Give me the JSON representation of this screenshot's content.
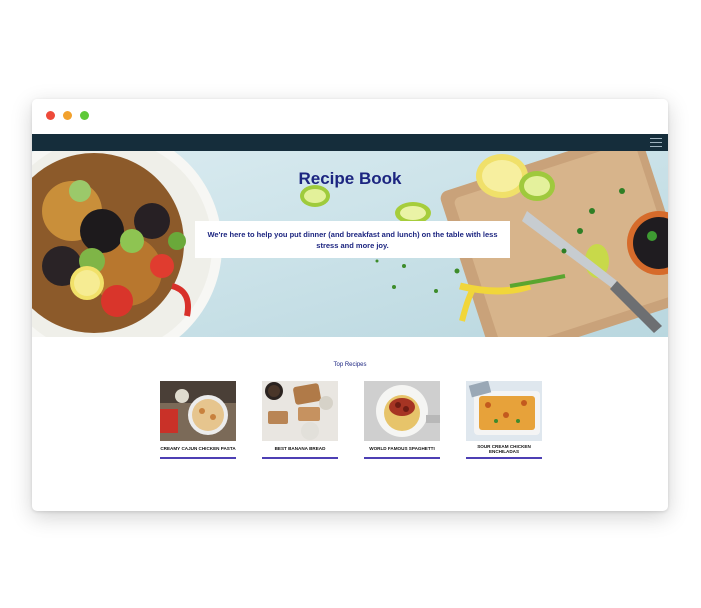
{
  "window": {
    "controls": [
      "close",
      "minimize",
      "maximize"
    ],
    "colors": {
      "close": "#ee4a3a",
      "minimize": "#f2a12d",
      "maximize": "#5fc939"
    }
  },
  "navbar": {
    "menu_icon": "hamburger-menu-icon",
    "background": "#152d3b"
  },
  "hero": {
    "title": "Recipe Book",
    "tagline": "We're here to help you put dinner (and breakfast and lunch) on the table with less stress and more joy.",
    "title_color": "#1c2580"
  },
  "top_recipes": {
    "heading": "Top Recipes",
    "items": [
      {
        "title": "CREAMY CAJUN CHICKEN PASTA"
      },
      {
        "title": "BEST BANANA BREAD"
      },
      {
        "title": "WORLD FAMOUS SPAGHETTI"
      },
      {
        "title": "SOUR CREAM CHICKEN ENCHILADAS"
      }
    ],
    "accent": "#4d3fb4"
  }
}
